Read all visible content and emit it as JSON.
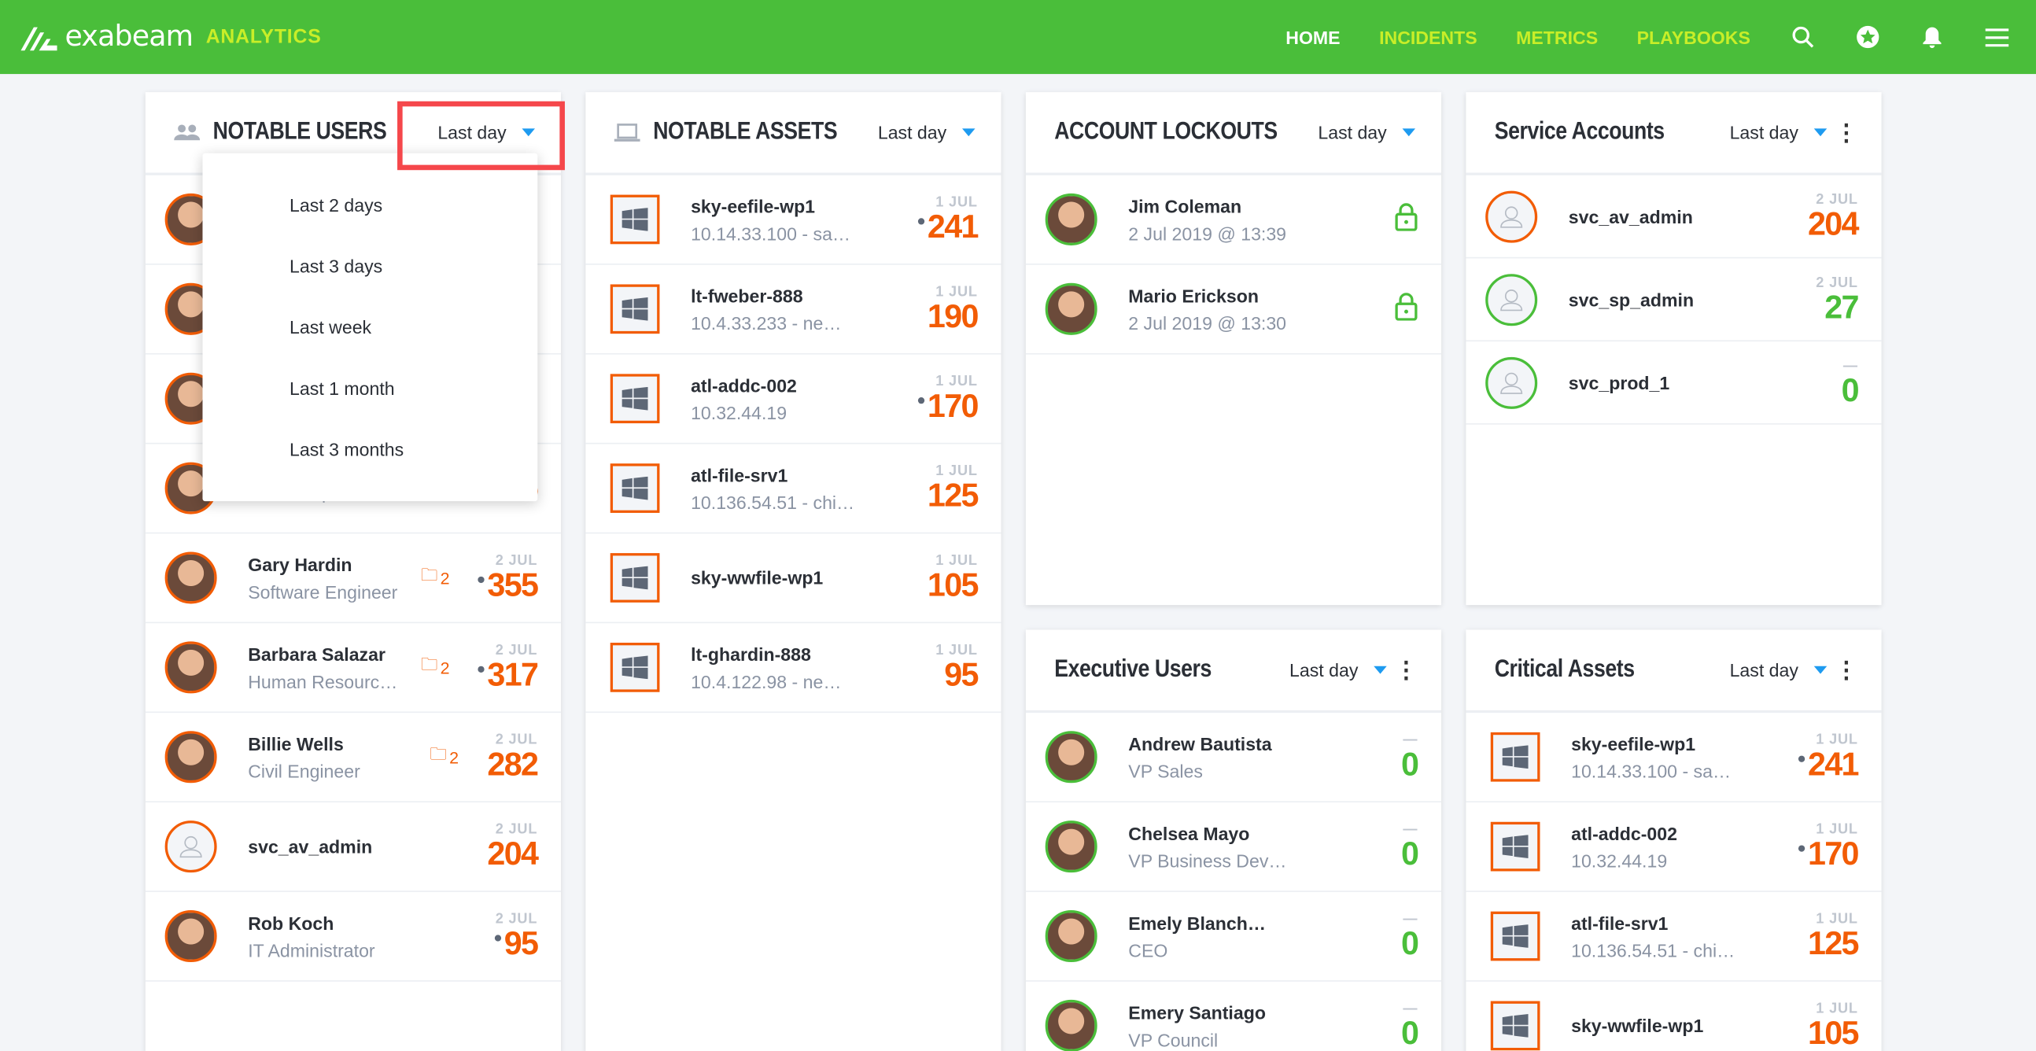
{
  "app": {
    "brand": "exabeam",
    "product": "ANALYTICS"
  },
  "nav": {
    "items": [
      {
        "label": "HOME",
        "active": true
      },
      {
        "label": "INCIDENTS"
      },
      {
        "label": "METRICS"
      },
      {
        "label": "PLAYBOOKS"
      }
    ],
    "icons": [
      "search-icon",
      "star-badge-icon",
      "bell-icon",
      "menu-icon"
    ]
  },
  "colors": {
    "brand": "#4abe3a",
    "accent": "#c8ee28",
    "risk_high": "#f25c05",
    "risk_low": "#4abe3a",
    "dropdown_caret": "#1e9bf0",
    "highlight": "#f5474b"
  },
  "notable_users": {
    "title": "NOTABLE USERS",
    "range": "Last day",
    "dropdown_options": [
      "Last 2 days",
      "Last 3 days",
      "Last week",
      "Last 1 month",
      "Last 3 months"
    ],
    "rows": [
      {
        "name": "",
        "sub": "",
        "date": "",
        "score": ""
      },
      {
        "name": "",
        "sub": "",
        "date": "",
        "score": ""
      },
      {
        "name": "",
        "sub": "",
        "date": "",
        "score": ""
      },
      {
        "name": "",
        "sub": "Sales Represent…",
        "date": "",
        "score": "355",
        "dot": true
      },
      {
        "name": "Gary Hardin",
        "sub": "Software Engineer",
        "folder": "2",
        "date": "2 JUL",
        "score": "355",
        "dot": true
      },
      {
        "name": "Barbara Salazar",
        "sub": "Human Resourc…",
        "folder": "2",
        "date": "2 JUL",
        "score": "317",
        "dot": true
      },
      {
        "name": "Billie Wells",
        "sub": "Civil Engineer",
        "folder": "2",
        "date": "2 JUL",
        "score": "282"
      },
      {
        "name": "svc_av_admin",
        "sub": "",
        "date": "2 JUL",
        "score": "204",
        "blank": true
      },
      {
        "name": "Rob Koch",
        "sub": "IT Administrator",
        "date": "2 JUL",
        "score": "95",
        "dot": true
      }
    ]
  },
  "notable_assets": {
    "title": "NOTABLE ASSETS",
    "range": "Last day",
    "rows": [
      {
        "name": "sky-eefile-wp1",
        "sub": "10.14.33.100 - sa…",
        "date": "1 JUL",
        "score": "241",
        "dot": true
      },
      {
        "name": "lt-fweber-888",
        "sub": "10.4.33.233 - ne…",
        "date": "1 JUL",
        "score": "190"
      },
      {
        "name": "atl-addc-002",
        "sub": "10.32.44.19",
        "date": "1 JUL",
        "score": "170",
        "dot": true
      },
      {
        "name": "atl-file-srv1",
        "sub": "10.136.54.51 - chi…",
        "date": "1 JUL",
        "score": "125"
      },
      {
        "name": "sky-wwfile-wp1",
        "sub": "",
        "date": "1 JUL",
        "score": "105"
      },
      {
        "name": "lt-ghardin-888",
        "sub": "10.4.122.98 - ne…",
        "date": "1 JUL",
        "score": "95"
      }
    ]
  },
  "account_lockouts": {
    "title": "ACCOUNT LOCKOUTS",
    "range": "Last day",
    "rows": [
      {
        "name": "Jim Coleman",
        "sub": "2 Jul 2019 @ 13:39"
      },
      {
        "name": "Mario Erickson",
        "sub": "2 Jul 2019 @ 13:30"
      }
    ]
  },
  "service_accounts": {
    "title": "Service Accounts",
    "range": "Last day",
    "rows": [
      {
        "name": "svc_av_admin",
        "date": "2 JUL",
        "score": "204",
        "level": "high"
      },
      {
        "name": "svc_sp_admin",
        "date": "2 JUL",
        "score": "27",
        "level": "low"
      },
      {
        "name": "svc_prod_1",
        "date": "—",
        "score": "0",
        "level": "low"
      }
    ]
  },
  "executive_users": {
    "title": "Executive Users",
    "range": "Last day",
    "rows": [
      {
        "name": "Andrew Bautista",
        "sub": "VP Sales",
        "date": "—",
        "score": "0"
      },
      {
        "name": "Chelsea Mayo",
        "sub": "VP Business Dev…",
        "date": "—",
        "score": "0"
      },
      {
        "name": "Emely Blanch…",
        "sub": "CEO",
        "date": "—",
        "score": "0"
      },
      {
        "name": "Emery Santiago",
        "sub": "VP Council",
        "date": "—",
        "score": "0"
      }
    ]
  },
  "critical_assets": {
    "title": "Critical Assets",
    "range": "Last day",
    "rows": [
      {
        "name": "sky-eefile-wp1",
        "sub": "10.14.33.100 - sa…",
        "date": "1 JUL",
        "score": "241",
        "dot": true
      },
      {
        "name": "atl-addc-002",
        "sub": "10.32.44.19",
        "date": "1 JUL",
        "score": "170",
        "dot": true
      },
      {
        "name": "atl-file-srv1",
        "sub": "10.136.54.51 - chi…",
        "date": "1 JUL",
        "score": "125"
      },
      {
        "name": "sky-wwfile-wp1",
        "sub": "",
        "date": "1 JUL",
        "score": "105"
      }
    ]
  }
}
